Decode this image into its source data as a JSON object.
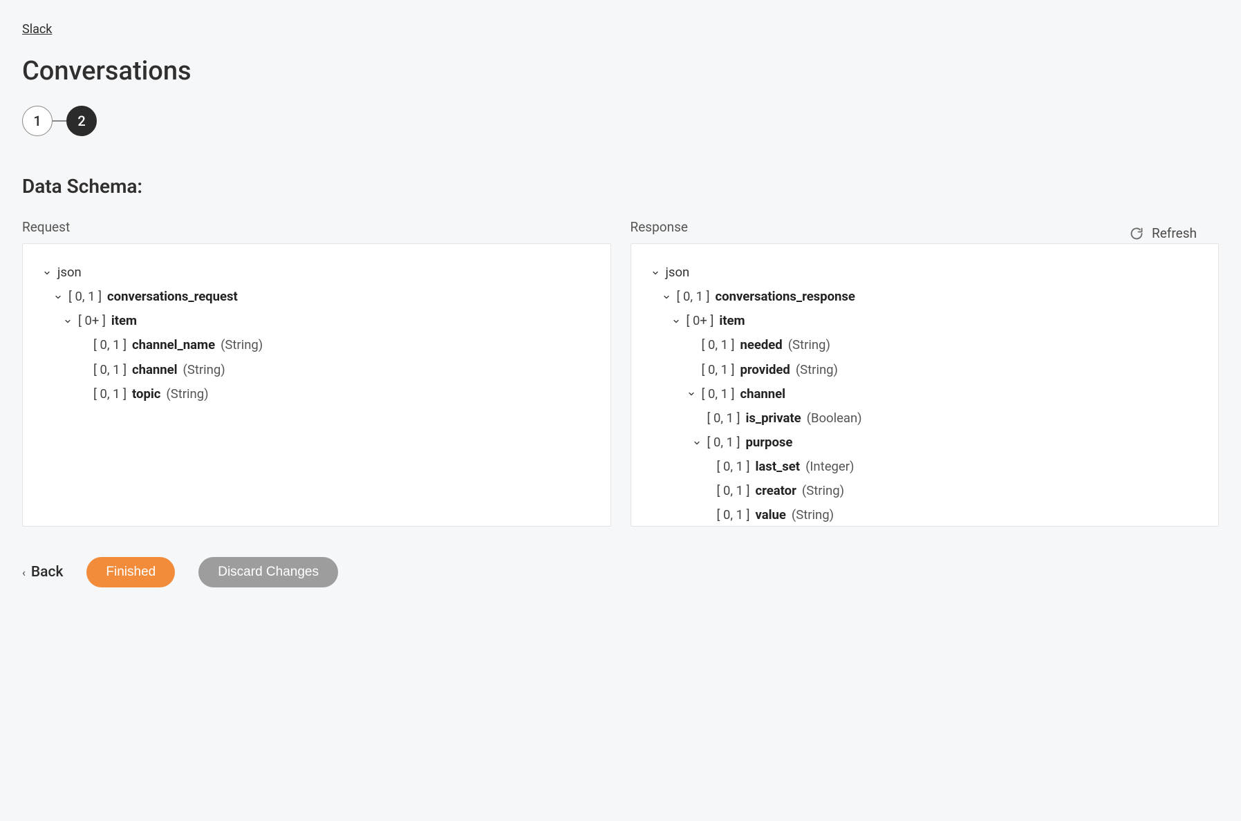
{
  "breadcrumb": {
    "label": "Slack"
  },
  "page": {
    "title": "Conversations"
  },
  "stepper": {
    "steps": [
      "1",
      "2"
    ],
    "active_index": 1
  },
  "section": {
    "title": "Data Schema:"
  },
  "refresh": {
    "label": "Refresh"
  },
  "panels": {
    "request": {
      "label": "Request",
      "root": "json",
      "tree": [
        {
          "indent": 0,
          "chevron": true,
          "text_plain": "json"
        },
        {
          "indent": 1,
          "chevron": true,
          "card": "[ 0, 1 ]",
          "name": "conversations_request"
        },
        {
          "indent": 2,
          "chevron": true,
          "card": "[ 0+ ]",
          "name": "item"
        },
        {
          "indent": 3,
          "chevron": false,
          "card": "[ 0, 1 ]",
          "name": "channel_name",
          "type": "(String)"
        },
        {
          "indent": 3,
          "chevron": false,
          "card": "[ 0, 1 ]",
          "name": "channel",
          "type": "(String)"
        },
        {
          "indent": 3,
          "chevron": false,
          "card": "[ 0, 1 ]",
          "name": "topic",
          "type": "(String)"
        }
      ]
    },
    "response": {
      "label": "Response",
      "root": "json",
      "tree": [
        {
          "indent": 0,
          "chevron": true,
          "text_plain": "json"
        },
        {
          "indent": 1,
          "chevron": true,
          "card": "[ 0, 1 ]",
          "name": "conversations_response"
        },
        {
          "indent": 2,
          "chevron": true,
          "card": "[ 0+ ]",
          "name": "item"
        },
        {
          "indent": 3,
          "chevron": false,
          "card": "[ 0, 1 ]",
          "name": "needed",
          "type": "(String)"
        },
        {
          "indent": 3,
          "chevron": false,
          "card": "[ 0, 1 ]",
          "name": "provided",
          "type": "(String)"
        },
        {
          "indent": 3,
          "chevron": true,
          "card": "[ 0, 1 ]",
          "name": "channel"
        },
        {
          "indent": 4,
          "chevron": false,
          "card": "[ 0, 1 ]",
          "name": "is_private",
          "type": "(Boolean)"
        },
        {
          "indent": 4,
          "chevron": true,
          "card": "[ 0, 1 ]",
          "name": "purpose"
        },
        {
          "indent": 5,
          "chevron": false,
          "card": "[ 0, 1 ]",
          "name": "last_set",
          "type": "(Integer)"
        },
        {
          "indent": 5,
          "chevron": false,
          "card": "[ 0, 1 ]",
          "name": "creator",
          "type": "(String)"
        },
        {
          "indent": 5,
          "chevron": false,
          "card": "[ 0, 1 ]",
          "name": "value",
          "type": "(String)"
        }
      ]
    }
  },
  "footer": {
    "back": "Back",
    "finished": "Finished",
    "discard": "Discard Changes"
  }
}
